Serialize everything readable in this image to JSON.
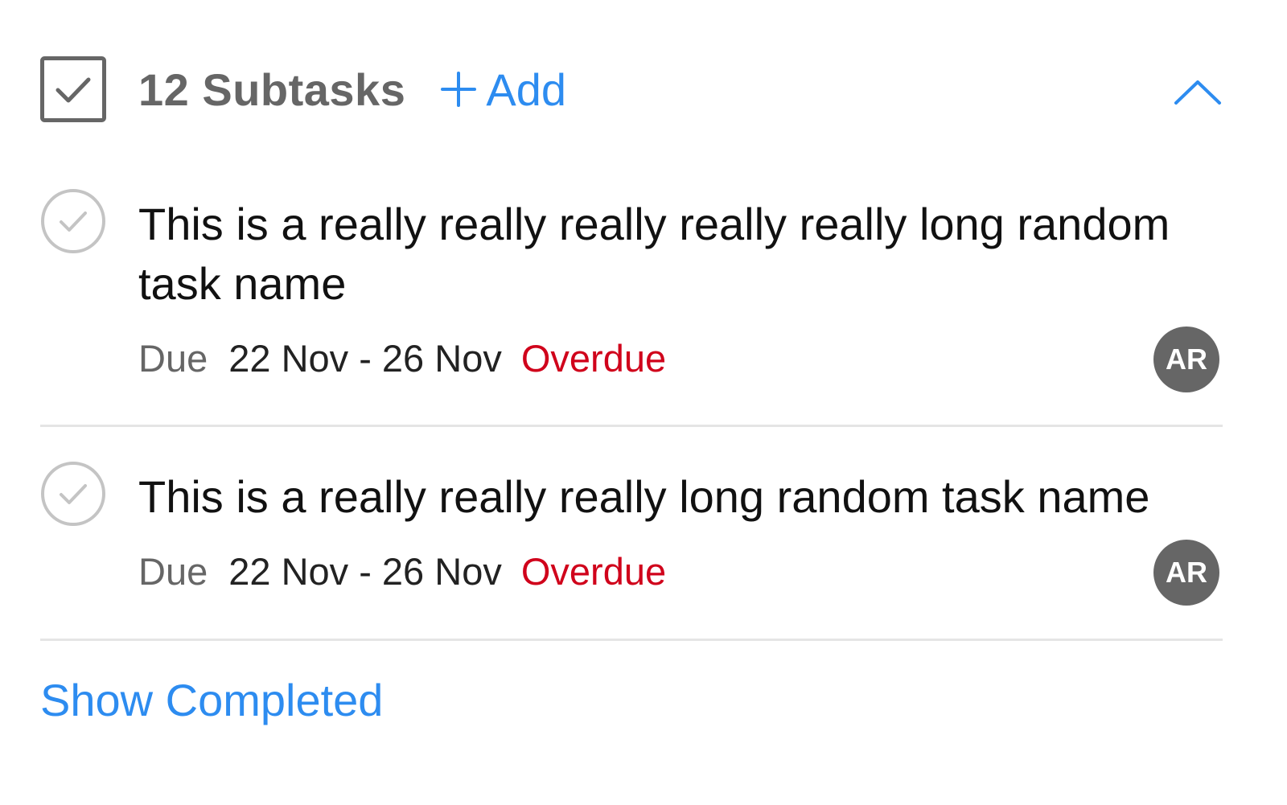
{
  "header": {
    "count_label": "12 Subtasks",
    "add_label": "Add",
    "icons": {
      "subtasks": "checkbox-checked-icon",
      "add": "plus-icon",
      "collapse": "chevron-up-icon"
    }
  },
  "tasks": [
    {
      "name": "This is a really really really really really long random task name",
      "due_label": "Due",
      "due_range": "22 Nov - 26 Nov",
      "status": "Overdue",
      "assignee_initials": "AR"
    },
    {
      "name": "This is a really really really long random task name",
      "due_label": "Due",
      "due_range": "22 Nov - 26 Nov",
      "status": "Overdue",
      "assignee_initials": "AR"
    }
  ],
  "footer": {
    "show_completed_label": "Show Completed"
  },
  "colors": {
    "accent": "#2d8cf0",
    "overdue": "#d0021b",
    "muted": "#666666",
    "divider": "#e5e5e5",
    "check_circle": "#c4c4c4"
  }
}
